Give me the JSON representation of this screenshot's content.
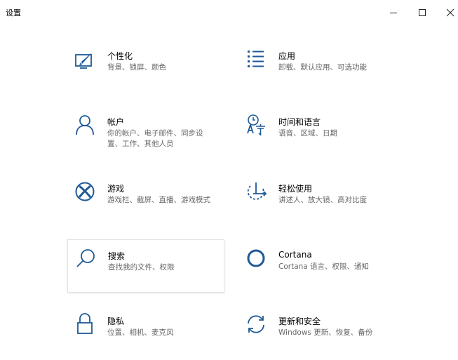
{
  "window": {
    "title": "设置"
  },
  "accent_color": "#1f5a96",
  "tiles": [
    {
      "icon": "personalization-icon",
      "name": "个性化",
      "desc": "背景、锁屏、颜色"
    },
    {
      "icon": "apps-icon",
      "name": "应用",
      "desc": "卸载、默认应用、可选功能"
    },
    {
      "icon": "accounts-icon",
      "name": "帐户",
      "desc": "你的帐户、电子邮件、同步设置、工作、其他人员"
    },
    {
      "icon": "time-language-icon",
      "name": "时间和语言",
      "desc": "语音、区域、日期"
    },
    {
      "icon": "xbox-icon",
      "name": "游戏",
      "desc": "游戏栏、截屏、直播、游戏模式"
    },
    {
      "icon": "ease-of-access-icon",
      "name": "轻松使用",
      "desc": "讲述人、放大镜、高对比度"
    },
    {
      "icon": "search-icon",
      "name": "搜索",
      "desc": "查找我的文件、权限"
    },
    {
      "icon": "cortana-icon",
      "name": "Cortana",
      "desc": "Cortana 语言、权限、通知"
    },
    {
      "icon": "lock-icon",
      "name": "隐私",
      "desc": "位置、相机、麦克风"
    },
    {
      "icon": "update-icon",
      "name": "更新和安全",
      "desc": "Windows 更新、恢复、备份"
    }
  ]
}
